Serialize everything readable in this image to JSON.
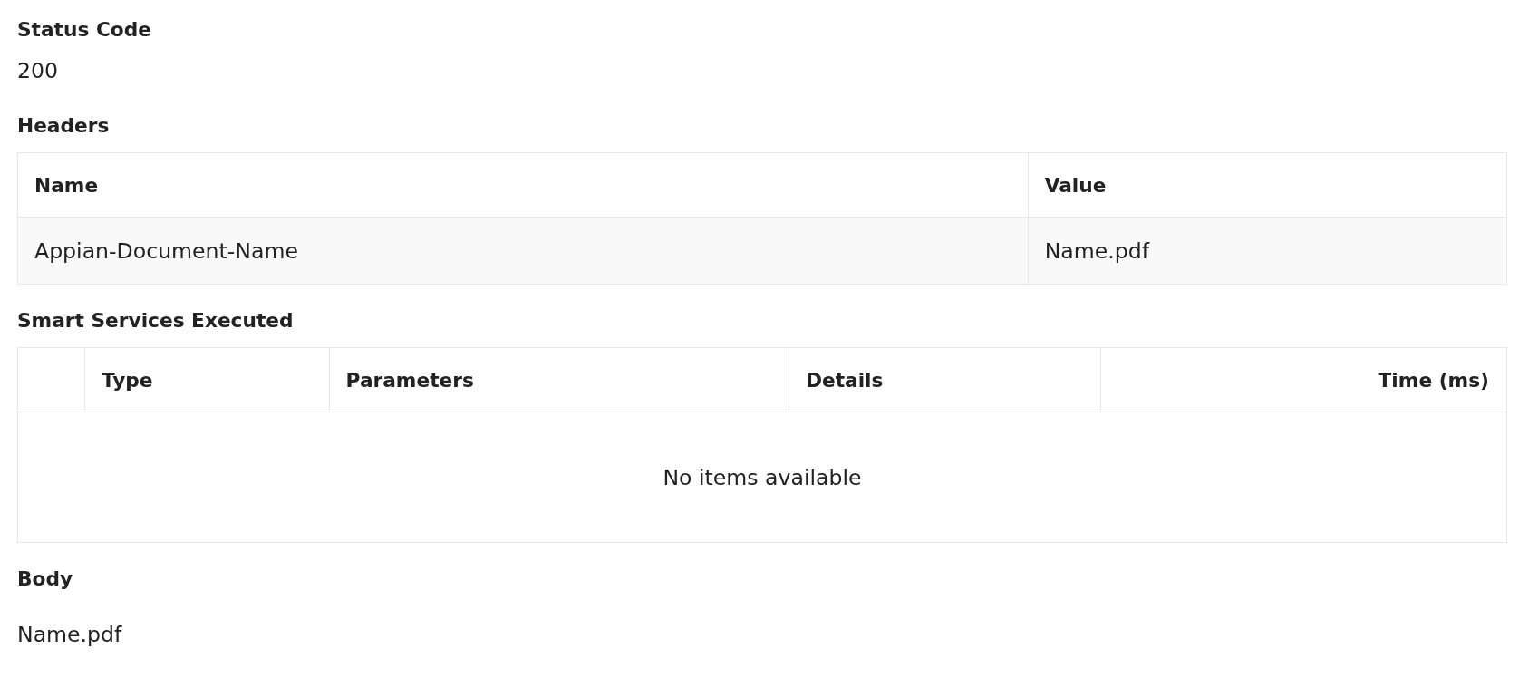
{
  "sections": [
    {
      "kind": "text",
      "label": "Status Code",
      "value": "200"
    },
    {
      "kind": "table",
      "label": "Headers",
      "columns": [
        {
          "label": "Name",
          "right_aligned": false
        },
        {
          "label": "Value",
          "right_aligned": false
        }
      ],
      "rows": [
        {
          "cells": [
            "Appian-Document-Name",
            "Name.pdf"
          ]
        }
      ]
    },
    {
      "kind": "table",
      "label": "Smart Services Executed",
      "blank_first_column": true,
      "columns": [
        {
          "label": "Type",
          "right_aligned": false
        },
        {
          "label": "Parameters",
          "right_aligned": false
        },
        {
          "label": "Details",
          "right_aligned": false
        },
        {
          "label": "Time (ms)",
          "right_aligned": true
        }
      ],
      "empty_message": "No items available"
    },
    {
      "kind": "text",
      "label": "Body",
      "value": "Name.pdf"
    }
  ]
}
